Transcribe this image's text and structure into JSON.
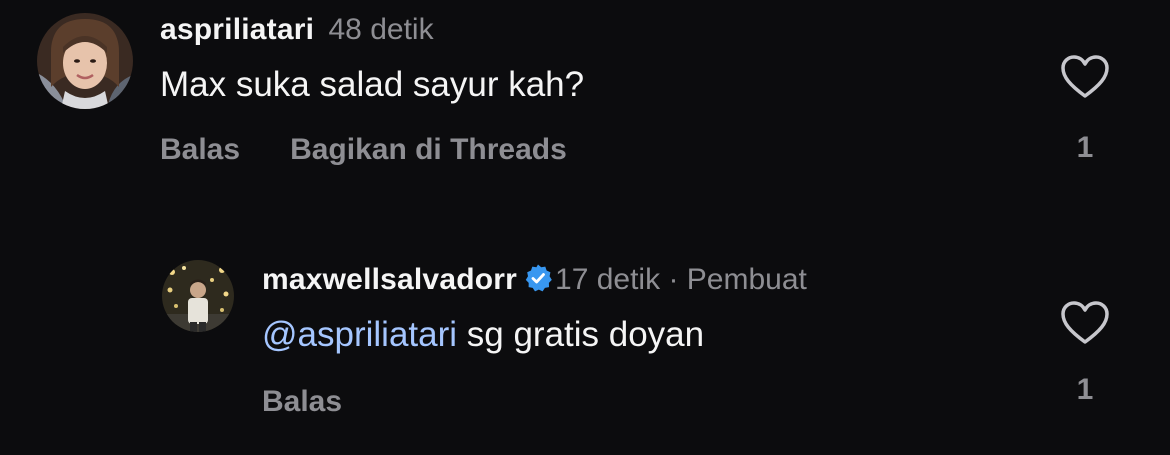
{
  "comments": [
    {
      "username": "aspriliatari",
      "time": "48 detik",
      "text": "Max suka salad sayur kah?",
      "reply_label": "Balas",
      "share_label": "Bagikan di Threads",
      "likes": "1",
      "avatar_icon": "profile-photo"
    },
    {
      "username": "maxwellsalvadorr",
      "verified": true,
      "time": "17 detik",
      "separator": "·",
      "role": "Pembuat",
      "mention": "@aspriliatari",
      "text": " sg gratis doyan",
      "reply_label": "Balas",
      "likes": "1",
      "avatar_icon": "profile-photo"
    }
  ],
  "colors": {
    "background": "#0c0c0e",
    "primary_text": "#f5f5f5",
    "secondary_text": "#8e8e93",
    "mention": "#a5c6ff",
    "verified_badge": "#3897f0"
  },
  "icons": {
    "like": "heart-outline-icon",
    "verified": "verified-badge-icon"
  }
}
